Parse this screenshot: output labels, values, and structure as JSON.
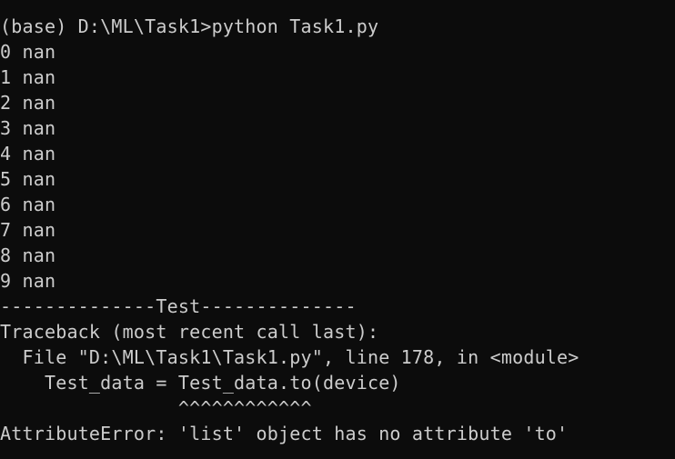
{
  "terminal": {
    "prompt_line": "(base) D:\\ML\\Task1>python Task1.py",
    "output_lines": [
      "0 nan",
      "1 nan",
      "2 nan",
      "3 nan",
      "4 nan",
      "5 nan",
      "6 nan",
      "7 nan",
      "8 nan",
      "9 nan"
    ],
    "separator": "--------------Test--------------",
    "traceback": {
      "header": "Traceback (most recent call last):",
      "file_line": "  File \"D:\\ML\\Task1\\Task1.py\", line 178, in <module>",
      "code_line": "    Test_data = Test_data.to(device)",
      "caret_line": "                ^^^^^^^^^^^^",
      "error": "AttributeError: 'list' object has no attribute 'to'"
    },
    "colors": {
      "background": "#0c0c0c",
      "foreground": "#cccccc"
    }
  }
}
